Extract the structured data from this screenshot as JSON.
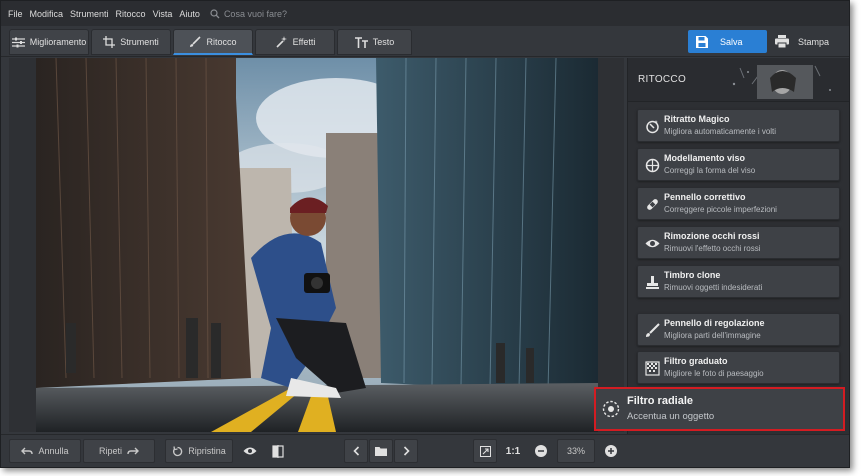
{
  "menu": {
    "items": [
      "File",
      "Modifica",
      "Strumenti",
      "Ritocco",
      "Vista",
      "Aiuto"
    ],
    "search_placeholder": "Cosa vuoi fare?"
  },
  "tabs": [
    {
      "label": "Miglioramento",
      "icon": "sliders-icon",
      "active": false
    },
    {
      "label": "Strumenti",
      "icon": "crop-icon",
      "active": false
    },
    {
      "label": "Ritocco",
      "icon": "brush-icon",
      "active": true
    },
    {
      "label": "Effetti",
      "icon": "magic-wand-icon",
      "active": false
    },
    {
      "label": "Testo",
      "icon": "text-icon",
      "active": false
    }
  ],
  "actions": {
    "save_label": "Salva",
    "print_label": "Stampa"
  },
  "panel": {
    "title": "RITOCCO",
    "tools": [
      {
        "name": "Ritratto Magico",
        "desc": "Migliora automaticamente i volti",
        "icon": "magic-portrait-icon"
      },
      {
        "name": "Modellamento viso",
        "desc": "Correggi la forma del viso",
        "icon": "face-shape-icon"
      },
      {
        "name": "Pennello correttivo",
        "desc": "Correggere piccole imperfezioni",
        "icon": "bandage-icon"
      },
      {
        "name": "Rimozione occhi rossi",
        "desc": "Rimuovi l'effetto occhi rossi",
        "icon": "eye-icon"
      },
      {
        "name": "Timbro clone",
        "desc": "Rimuovi oggetti indesiderati",
        "icon": "stamp-icon"
      },
      {
        "name": "Pennello di regolazione",
        "desc": "Migliora parti dell'immagine",
        "icon": "brush-icon"
      },
      {
        "name": "Filtro graduato",
        "desc": "Migliore le foto di paesaggio",
        "icon": "gradient-icon"
      }
    ],
    "highlight": {
      "name": "Filtro radiale",
      "desc": "Accentua un oggetto",
      "icon": "radial-filter-icon"
    }
  },
  "bottom": {
    "undo_label": "Annulla",
    "redo_label": "Ripeti",
    "reset_label": "Ripristina",
    "zoom_1to1": "1:1",
    "zoom_value": "33%"
  },
  "colors": {
    "accent": "#2a7fd4",
    "highlight_border": "#d31c22"
  }
}
